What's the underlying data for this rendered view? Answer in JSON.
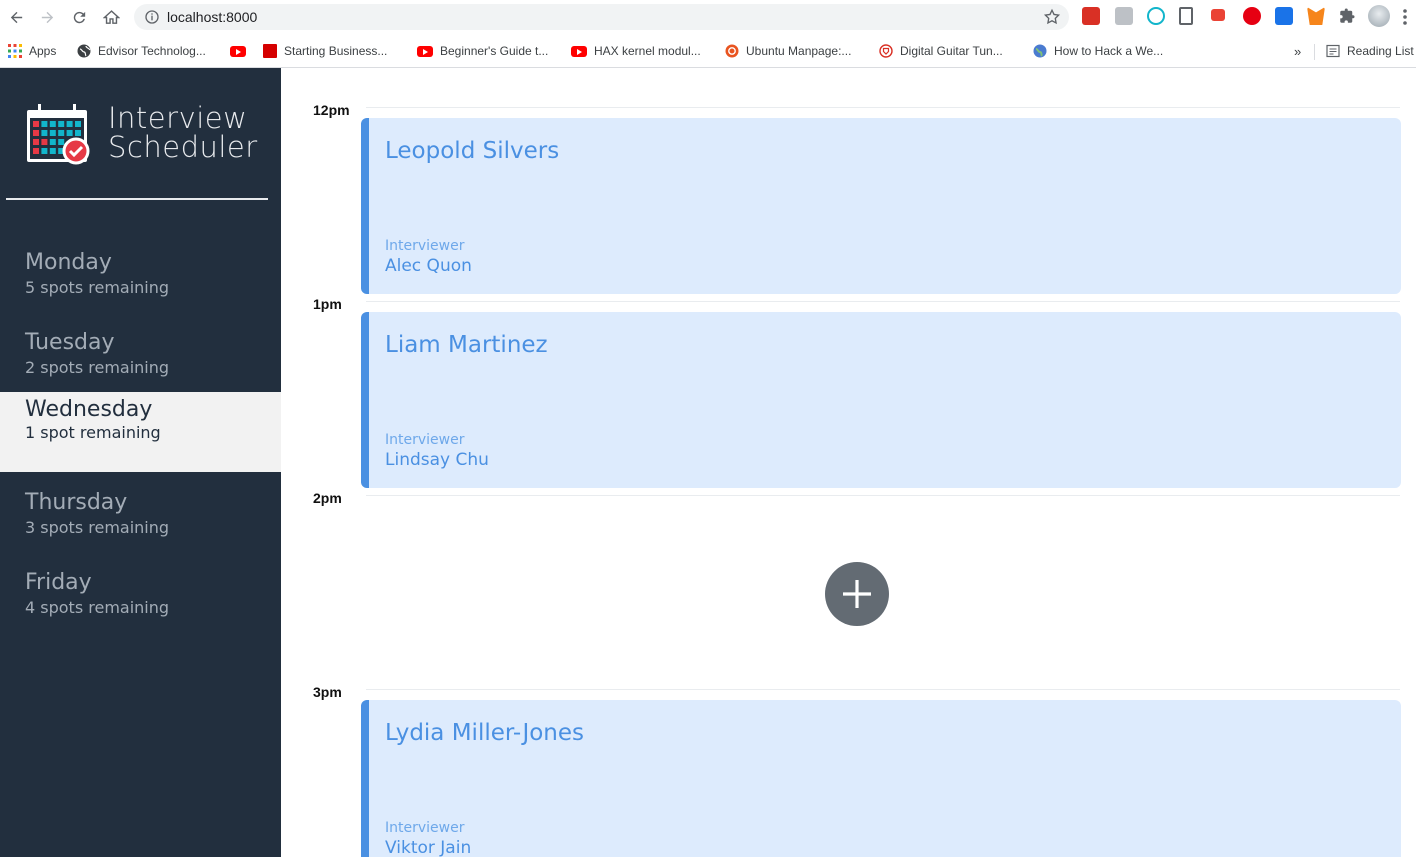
{
  "browser": {
    "url": "localhost:8000",
    "apps_label": "Apps",
    "bookmarks": [
      {
        "label": "Edvisor Technolog...",
        "icon": "globe-icon"
      },
      {
        "label": "",
        "icon": "youtube-icon"
      },
      {
        "label": "Starting Business...",
        "icon": "red-square-icon"
      },
      {
        "label": "Beginner's Guide t...",
        "icon": "youtube-icon"
      },
      {
        "label": "HAX kernel modul...",
        "icon": "youtube-icon"
      },
      {
        "label": "Ubuntu Manpage:...",
        "icon": "ubuntu-icon"
      },
      {
        "label": "Digital Guitar Tun...",
        "icon": "guitar-icon"
      },
      {
        "label": "How to Hack a We...",
        "icon": "globe-icon"
      }
    ],
    "overflow_label": "»",
    "reading_list_label": "Reading List"
  },
  "app": {
    "title_line1": "Interview",
    "title_line2": "Scheduler"
  },
  "days": [
    {
      "name": "Monday",
      "spots": "5 spots remaining",
      "selected": false
    },
    {
      "name": "Tuesday",
      "spots": "2 spots remaining",
      "selected": false
    },
    {
      "name": "Wednesday",
      "spots": "1 spot remaining",
      "selected": true
    },
    {
      "name": "Thursday",
      "spots": "3 spots remaining",
      "selected": false
    },
    {
      "name": "Friday",
      "spots": "4 spots remaining",
      "selected": false
    }
  ],
  "appointments": [
    {
      "time": "12pm",
      "student": "Leopold Silvers",
      "interviewer_label": "Interviewer",
      "interviewer": "Alec Quon"
    },
    {
      "time": "1pm",
      "student": "Liam Martinez",
      "interviewer_label": "Interviewer",
      "interviewer": "Lindsay Chu"
    },
    {
      "time": "2pm",
      "empty": true
    },
    {
      "time": "3pm",
      "student": "Lydia Miller-Jones",
      "interviewer_label": "Interviewer",
      "interviewer": "Viktor Jain"
    }
  ],
  "colors": {
    "sidebar_bg": "#222f3e",
    "selected_bg": "#f2f2f2",
    "card_bg": "#ddebfd",
    "accent": "#4a90e2",
    "add_button": "#636b73"
  }
}
